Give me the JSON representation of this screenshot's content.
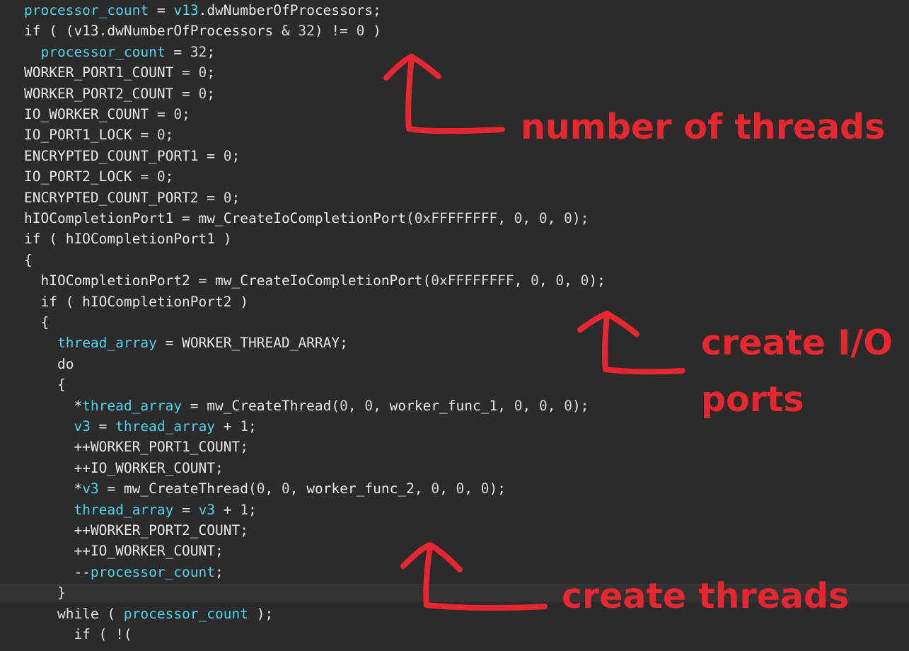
{
  "colors": {
    "background": "#2b2b2b",
    "variable": "#4fd2ec",
    "number": "#d4d4d4",
    "text": "#e6e6e6",
    "annotation": "#e8262f"
  },
  "code_lines": [
    [
      [
        "processor_count",
        "v"
      ],
      [
        " = ",
        "p"
      ],
      [
        "v13",
        "v"
      ],
      [
        ".dwNumberOfProcessors;",
        "p"
      ]
    ],
    [
      [
        "if ( (v13.dwNumberOfProcessors & ",
        "p"
      ],
      [
        "32",
        "n"
      ],
      [
        ") != ",
        "p"
      ],
      [
        "0",
        "n"
      ],
      [
        " )",
        "p"
      ]
    ],
    [
      [
        "  ",
        "p"
      ],
      [
        "processor_count",
        "v"
      ],
      [
        " = ",
        "p"
      ],
      [
        "32",
        "n"
      ],
      [
        ";",
        "p"
      ]
    ],
    [
      [
        "WORKER_PORT1_COUNT = ",
        "p"
      ],
      [
        "0",
        "n"
      ],
      [
        ";",
        "p"
      ]
    ],
    [
      [
        "WORKER_PORT2_COUNT = ",
        "p"
      ],
      [
        "0",
        "n"
      ],
      [
        ";",
        "p"
      ]
    ],
    [
      [
        "IO_WORKER_COUNT = ",
        "p"
      ],
      [
        "0",
        "n"
      ],
      [
        ";",
        "p"
      ]
    ],
    [
      [
        "IO_PORT1_LOCK = ",
        "p"
      ],
      [
        "0",
        "n"
      ],
      [
        ";",
        "p"
      ]
    ],
    [
      [
        "ENCRYPTED_COUNT_PORT1 = ",
        "p"
      ],
      [
        "0",
        "n"
      ],
      [
        ";",
        "p"
      ]
    ],
    [
      [
        "IO_PORT2_LOCK = ",
        "p"
      ],
      [
        "0",
        "n"
      ],
      [
        ";",
        "p"
      ]
    ],
    [
      [
        "ENCRYPTED_COUNT_PORT2 = ",
        "p"
      ],
      [
        "0",
        "n"
      ],
      [
        ";",
        "p"
      ]
    ],
    [
      [
        "hIOCompletionPort1 = mw_CreateIoCompletionPort(",
        "p"
      ],
      [
        "0xFFFFFFFF",
        "n"
      ],
      [
        ", ",
        "p"
      ],
      [
        "0",
        "n"
      ],
      [
        ", ",
        "p"
      ],
      [
        "0",
        "n"
      ],
      [
        ", ",
        "p"
      ],
      [
        "0",
        "n"
      ],
      [
        ");",
        "p"
      ]
    ],
    [
      [
        "if ( hIOCompletionPort1 )",
        "p"
      ]
    ],
    [
      [
        "{",
        "p"
      ]
    ],
    [
      [
        "  hIOCompletionPort2 = mw_CreateIoCompletionPort(",
        "p"
      ],
      [
        "0xFFFFFFFF",
        "n"
      ],
      [
        ", ",
        "p"
      ],
      [
        "0",
        "n"
      ],
      [
        ", ",
        "p"
      ],
      [
        "0",
        "n"
      ],
      [
        ", ",
        "p"
      ],
      [
        "0",
        "n"
      ],
      [
        ");",
        "p"
      ]
    ],
    [
      [
        "  if ( hIOCompletionPort2 )",
        "p"
      ]
    ],
    [
      [
        "  {",
        "p"
      ]
    ],
    [
      [
        "    ",
        "p"
      ],
      [
        "thread_array",
        "v"
      ],
      [
        " = WORKER_THREAD_ARRAY;",
        "p"
      ]
    ],
    [
      [
        "    do",
        "p"
      ]
    ],
    [
      [
        "    {",
        "p"
      ]
    ],
    [
      [
        "      *",
        "p"
      ],
      [
        "thread_array",
        "v"
      ],
      [
        " = mw_CreateThread(",
        "p"
      ],
      [
        "0",
        "n"
      ],
      [
        ", ",
        "p"
      ],
      [
        "0",
        "n"
      ],
      [
        ", worker_func_1, ",
        "p"
      ],
      [
        "0",
        "n"
      ],
      [
        ", ",
        "p"
      ],
      [
        "0",
        "n"
      ],
      [
        ", ",
        "p"
      ],
      [
        "0",
        "n"
      ],
      [
        ");",
        "p"
      ]
    ],
    [
      [
        "      ",
        "p"
      ],
      [
        "v3",
        "v"
      ],
      [
        " = ",
        "p"
      ],
      [
        "thread_array",
        "v"
      ],
      [
        " + ",
        "p"
      ],
      [
        "1",
        "n"
      ],
      [
        ";",
        "p"
      ]
    ],
    [
      [
        "      ++WORKER_PORT1_COUNT;",
        "p"
      ]
    ],
    [
      [
        "      ++IO_WORKER_COUNT;",
        "p"
      ]
    ],
    [
      [
        "      *",
        "p"
      ],
      [
        "v3",
        "v"
      ],
      [
        " = mw_CreateThread(",
        "p"
      ],
      [
        "0",
        "n"
      ],
      [
        ", ",
        "p"
      ],
      [
        "0",
        "n"
      ],
      [
        ", worker_func_2, ",
        "p"
      ],
      [
        "0",
        "n"
      ],
      [
        ", ",
        "p"
      ],
      [
        "0",
        "n"
      ],
      [
        ", ",
        "p"
      ],
      [
        "0",
        "n"
      ],
      [
        ");",
        "p"
      ]
    ],
    [
      [
        "      ",
        "p"
      ],
      [
        "thread_array",
        "v"
      ],
      [
        " = ",
        "p"
      ],
      [
        "v3",
        "v"
      ],
      [
        " + ",
        "p"
      ],
      [
        "1",
        "n"
      ],
      [
        ";",
        "p"
      ]
    ],
    [
      [
        "      ++WORKER_PORT2_COUNT;",
        "p"
      ]
    ],
    [
      [
        "      ++IO_WORKER_COUNT;",
        "p"
      ]
    ],
    [
      [
        "      --",
        "p"
      ],
      [
        "processor_count",
        "v"
      ],
      [
        ";",
        "p"
      ]
    ],
    [
      [
        "    }",
        "p"
      ]
    ],
    [
      [
        "    while ( ",
        "p"
      ],
      [
        "processor_count",
        "v"
      ],
      [
        " );",
        "p"
      ]
    ],
    [
      [
        "      if ( !( ",
        "p"
      ]
    ]
  ],
  "highlighted_line": 28,
  "annotations": {
    "threads_count": "number of threads",
    "io_ports_1": "create I/O",
    "io_ports_2": "ports",
    "create_threads": "create threads"
  }
}
